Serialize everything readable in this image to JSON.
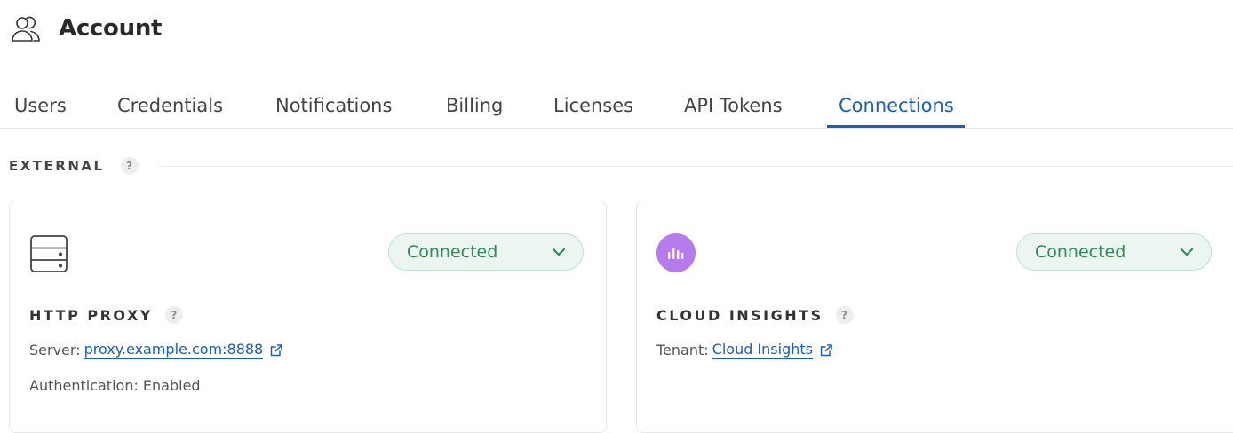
{
  "header": {
    "title": "Account",
    "icon": "users-icon"
  },
  "tabs": [
    {
      "label": "Users"
    },
    {
      "label": "Credentials"
    },
    {
      "label": "Notifications"
    },
    {
      "label": "Billing"
    },
    {
      "label": "Licenses"
    },
    {
      "label": "API Tokens"
    },
    {
      "label": "Connections",
      "active": true
    }
  ],
  "section": {
    "label": "EXTERNAL",
    "help": "?"
  },
  "cards": [
    {
      "icon": "server-icon",
      "status": "Connected",
      "title": "HTTP PROXY",
      "help": "?",
      "server_label": "Server:",
      "server_value": "proxy.example.com:8888",
      "auth_text": "Authentication: Enabled"
    },
    {
      "icon": "cloud-insights-icon",
      "status": "Connected",
      "title": "CLOUD INSIGHTS",
      "help": "?",
      "tenant_label": "Tenant:",
      "tenant_value": "Cloud Insights"
    }
  ],
  "colors": {
    "accent": "#1b5fb0",
    "status_green": "#2f8a5b",
    "status_bg": "#eaf6ef",
    "insights_purple": "#b57bea"
  }
}
